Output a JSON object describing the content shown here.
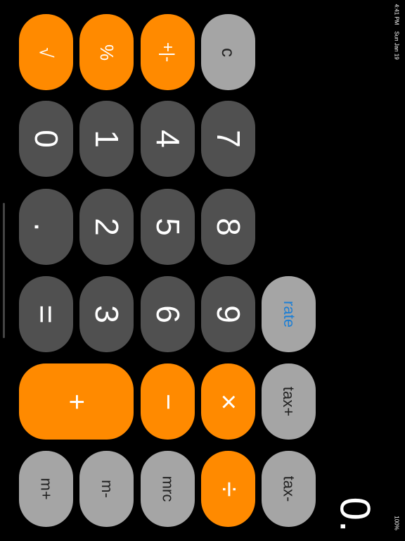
{
  "status": {
    "time": "4:41 PM",
    "date": "Sun Jan 19",
    "battery": "100%"
  },
  "display": {
    "value": "0."
  },
  "keys": {
    "sqrt": "√",
    "percent": "%",
    "plus_minus": "+|-",
    "clear": "c",
    "d0": "0",
    "d1": "1",
    "d4": "4",
    "d7": "7",
    "dot": ".",
    "d2": "2",
    "d5": "5",
    "d8": "8",
    "equals": "=",
    "d3": "3",
    "d6": "6",
    "d9": "9",
    "rate": "rate",
    "add": "+",
    "subtract": "−",
    "multiply": "×",
    "tax_plus": "tax+",
    "m_plus": "m+",
    "m_minus": "m-",
    "mrc": "mrc",
    "divide": "÷",
    "tax_minus": "tax-"
  },
  "colors": {
    "orange": "#ff8a00",
    "dark_gray": "#505050",
    "light_gray": "#a5a5a5",
    "rate_text": "#1e7fd4"
  }
}
